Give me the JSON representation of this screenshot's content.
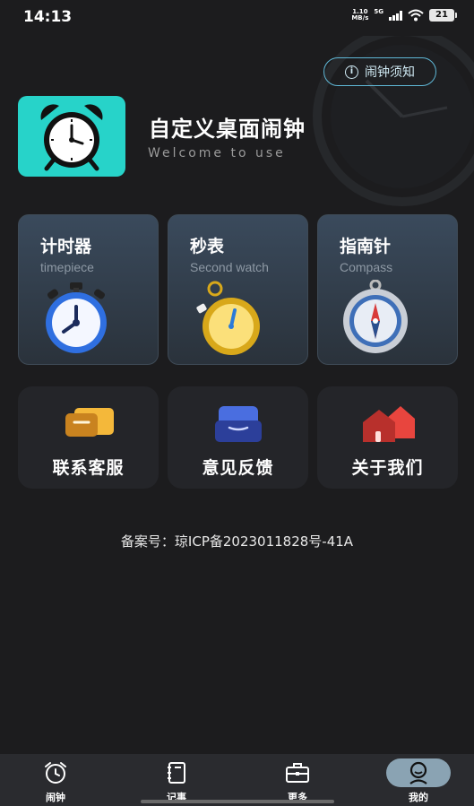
{
  "status_bar": {
    "time": "14:13",
    "net_speed_value": "1.10",
    "net_speed_unit": "MB/s",
    "network": "5G",
    "battery": "21"
  },
  "header": {
    "notice_label": "闹钟须知",
    "app_title": "自定义桌面闹钟",
    "app_subtitle": "Welcome to use"
  },
  "tools": [
    {
      "title": "计时器",
      "subtitle": "timepiece",
      "icon": "timer-icon"
    },
    {
      "title": "秒表",
      "subtitle": "Second watch",
      "icon": "stopwatch-icon"
    },
    {
      "title": "指南针",
      "subtitle": "Compass",
      "icon": "compass-icon"
    }
  ],
  "links": [
    {
      "label": "联系客服",
      "icon": "chat-icon"
    },
    {
      "label": "意见反馈",
      "icon": "inbox-icon"
    },
    {
      "label": "关于我们",
      "icon": "home-icon"
    }
  ],
  "icp": "备案号：琼ICP备2023011828号-41A",
  "tab_bar": {
    "items": [
      {
        "label": "闹钟",
        "icon": "alarm-icon",
        "active": false
      },
      {
        "label": "记事",
        "icon": "notebook-icon",
        "active": false
      },
      {
        "label": "更多",
        "icon": "briefcase-icon",
        "active": false
      },
      {
        "label": "我的",
        "icon": "profile-icon",
        "active": true
      }
    ]
  },
  "colors": {
    "background": "#1c1c1e",
    "accent_teal": "#27d3c9",
    "notice_border": "#5fb7d6"
  }
}
